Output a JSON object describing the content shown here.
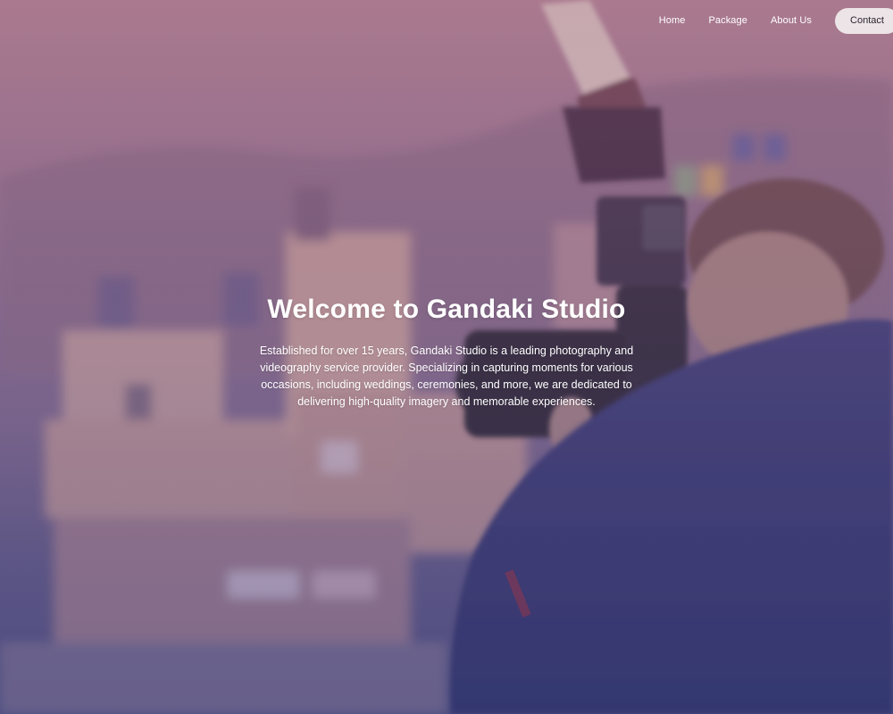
{
  "nav": {
    "items": [
      {
        "label": "Home"
      },
      {
        "label": "Package"
      },
      {
        "label": "About Us"
      }
    ],
    "contact_label": "Contact"
  },
  "hero": {
    "title": "Welcome to Gandaki Studio",
    "description": "Established for over 15 years, Gandaki Studio is a leading photography and videography service provider. Specializing in capturing moments for various occasions, including weddings, ceremonies, and more, we are dedicated to delivering high-quality imagery and memorable experiences."
  },
  "colors": {
    "overlay_top": "#b58a9b",
    "overlay_bottom": "#4f4f7e",
    "contact_bg": "#ece4e6",
    "text": "#ffffff"
  }
}
